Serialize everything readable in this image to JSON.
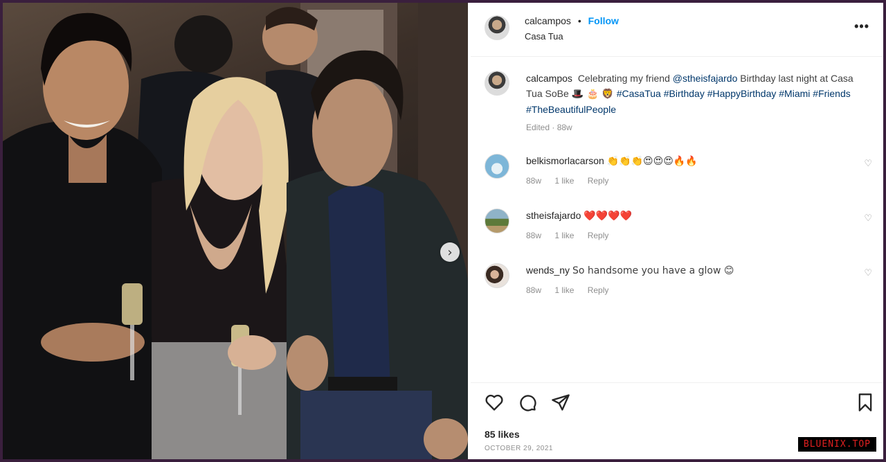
{
  "post": {
    "username": "calcampos",
    "separator": "•",
    "follow_label": "Follow",
    "location": "Casa Tua",
    "more_icon": "more-options-icon"
  },
  "caption": {
    "username": "calcampos",
    "text_before": "Celebrating my friend",
    "mention": "@stheisfajardo",
    "text_after": "Birthday last night at Casa Tua SoBe",
    "emojis": "🎩 🎂 🦁",
    "hashtags": [
      "#CasaTua",
      "#Birthday",
      "#HappyBirthday",
      "#Miami",
      "#Friends",
      "#TheBeautifulPeople"
    ],
    "edited": "Edited · 88w"
  },
  "comments": [
    {
      "username": "belkismorlacarson",
      "text": "👏👏👏😍😍😍🔥🔥",
      "age": "88w",
      "likes": "1 like",
      "reply": "Reply"
    },
    {
      "username": "stheisfajardo",
      "text": "❤️❤️❤️❤️",
      "age": "88w",
      "likes": "1 like",
      "reply": "Reply"
    },
    {
      "username": "wends_ny",
      "text": "So handsome you have a glow 😊",
      "age": "88w",
      "likes": "1 like",
      "reply": "Reply"
    }
  ],
  "actions": {
    "like_icon": "heart-icon",
    "comment_icon": "comment-icon",
    "share_icon": "share-icon",
    "save_icon": "bookmark-icon"
  },
  "likes": "85 likes",
  "date": "OCTOBER 29, 2021",
  "watermark": "BLUENIX.TOP",
  "colors": {
    "follow": "#0095f6",
    "hashtag": "#00376b",
    "muted": "#8e8e8e",
    "border": "#3a1f3d"
  }
}
